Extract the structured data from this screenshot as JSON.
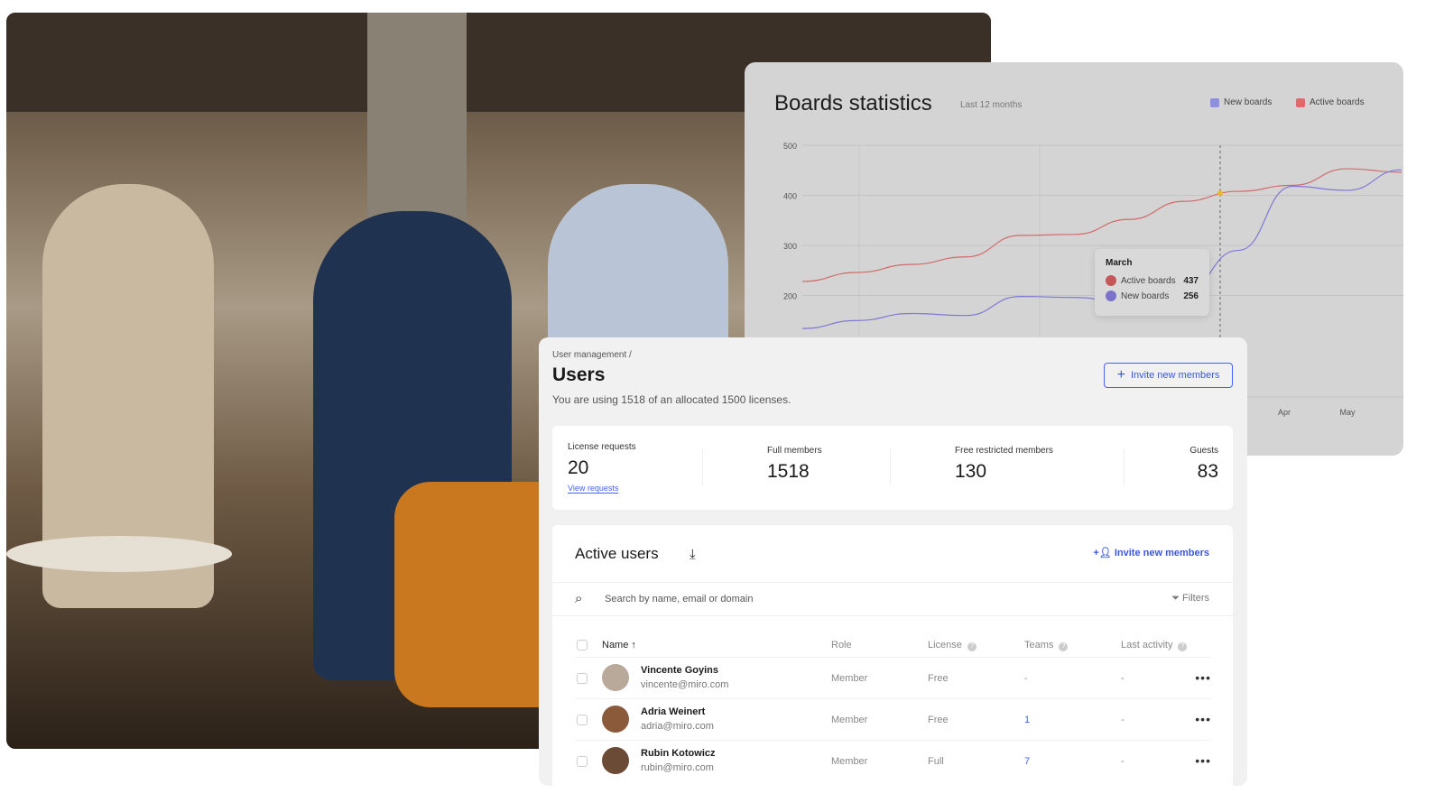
{
  "chart_panel": {
    "title": "Boards statistics",
    "subtitle": "Last 12 months",
    "legend": [
      {
        "label": "New boards",
        "color": "#8f8fe0"
      },
      {
        "label": "Active boards",
        "color": "#e06a6a"
      }
    ],
    "tooltip": {
      "title": "March",
      "rows": [
        {
          "label": "Active boards",
          "value": "437",
          "color": "#c45858"
        },
        {
          "label": "New boards",
          "value": "256",
          "color": "#7a72cc"
        }
      ]
    }
  },
  "chart_data": {
    "type": "line",
    "title": "Boards statistics",
    "subtitle": "Last 12 months",
    "y_ticks": [
      200,
      300,
      400,
      500
    ],
    "ylim": [
      100,
      500
    ],
    "x_tick_labels": [
      "Apr",
      "May"
    ],
    "grid": true,
    "legend_position": "top-right",
    "highlighted": "March",
    "series": [
      {
        "name": "Active boards",
        "color": "#d26a6a",
        "values": [
          228,
          246,
          262,
          277,
          320,
          322,
          352,
          388,
          408,
          420,
          453,
          446
        ]
      },
      {
        "name": "New boards",
        "color": "#8078d4",
        "values": [
          134,
          150,
          164,
          160,
          198,
          196,
          185,
          205,
          290,
          418,
          410,
          451
        ]
      }
    ]
  },
  "users": {
    "breadcrumb": "User management /",
    "title": "Users",
    "description": "You are using 1518 of an allocated 1500 licenses.",
    "invite_button": "Invite new members",
    "stats": [
      {
        "label": "License requests",
        "value": "20",
        "link": "View requests"
      },
      {
        "label": "Full members",
        "value": "1518"
      },
      {
        "label": "Free restricted members",
        "value": "130"
      },
      {
        "label": "Guests",
        "value": "83"
      }
    ],
    "active": {
      "title": "Active users",
      "invite": "Invite new members",
      "search_placeholder": "Search by name, email or domain",
      "filters": "Filters",
      "columns": {
        "name": "Name",
        "role": "Role",
        "license": "License",
        "teams": "Teams",
        "last": "Last activity"
      },
      "rows": [
        {
          "name": "Vincente Goyins",
          "email": "vincente@miro.com",
          "role": "Member",
          "license": "Free",
          "teams": "-",
          "last": "-"
        },
        {
          "name": "Adria Weinert",
          "email": "adria@miro.com",
          "role": "Member",
          "license": "Free",
          "teams": "1",
          "last": "-"
        },
        {
          "name": "Rubin Kotowicz",
          "email": "rubin@miro.com",
          "role": "Member",
          "license": "Full",
          "teams": "7",
          "last": "-"
        }
      ]
    }
  }
}
